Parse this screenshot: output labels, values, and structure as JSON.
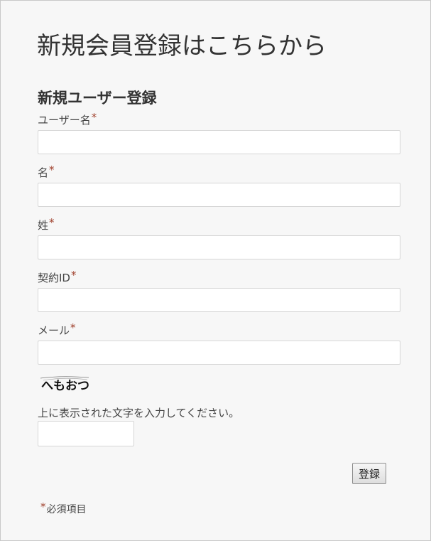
{
  "page": {
    "title": "新規会員登録はこちらから"
  },
  "form": {
    "title": "新規ユーザー登録",
    "required_marker": "*",
    "fields": [
      {
        "label": "ユーザー名",
        "value": "",
        "placeholder": ""
      },
      {
        "label": "名",
        "value": "",
        "placeholder": ""
      },
      {
        "label": "姓",
        "value": "",
        "placeholder": ""
      },
      {
        "label": "契約ID",
        "value": "",
        "placeholder": ""
      },
      {
        "label": "メール",
        "value": "",
        "placeholder": ""
      }
    ],
    "captcha": {
      "image_text": "へもおつ",
      "instruction": "上に表示された文字を入力してください。",
      "value": ""
    },
    "submit_label": "登録",
    "required_note": "必須項目"
  },
  "colors": {
    "required_marker": "#a0412d",
    "background": "#f7f7f7",
    "input_border": "#d6d6d6"
  }
}
